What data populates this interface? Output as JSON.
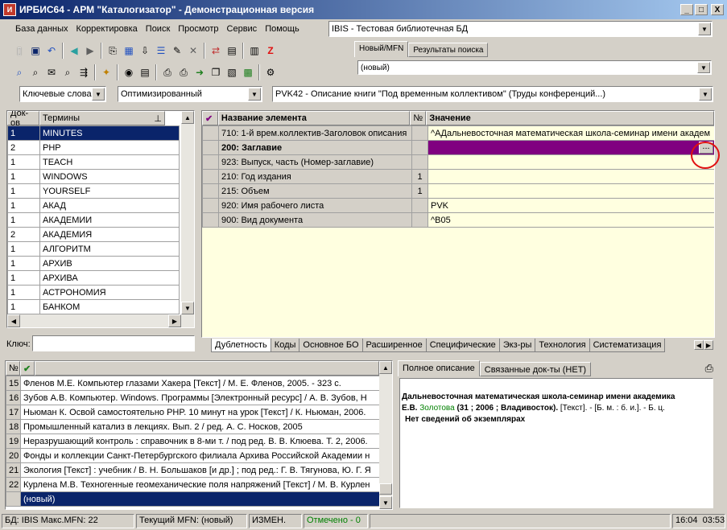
{
  "window": {
    "title": "ИРБИС64 - АРМ \"Каталогизатор\" - Демонстрационная версия",
    "min": "_",
    "max": "□",
    "close": "X"
  },
  "menu": [
    "База данных",
    "Корректировка",
    "Поиск",
    "Просмотр",
    "Сервис",
    "Помощь"
  ],
  "db_select": "IBIS - Тестовая библиотечная БД",
  "top_tabs": [
    "Новый/MFN",
    "Результаты поиска"
  ],
  "mfn_select": "(новый)",
  "search_mode": "Ключевые слова",
  "search_type": "Оптимизированный",
  "worksheet": "PVK42 - Описание книги \"Под временным коллективом\" (Труды конференций...)",
  "dict": {
    "col_docs": "Док-ов",
    "col_terms": "Термины",
    "key_label": "Ключ:",
    "rows": [
      [
        "1",
        "MINUTES"
      ],
      [
        "2",
        "PHP"
      ],
      [
        "1",
        "TEACH"
      ],
      [
        "1",
        "WINDOWS"
      ],
      [
        "1",
        "YOURSELF"
      ],
      [
        "1",
        "АКАД"
      ],
      [
        "1",
        "АКАДЕМИИ"
      ],
      [
        "2",
        "АКАДЕМИЯ"
      ],
      [
        "1",
        "АЛГОРИТМ"
      ],
      [
        "1",
        "АРХИВ"
      ],
      [
        "1",
        "АРХИВА"
      ],
      [
        "1",
        "АСТРОНОМИЯ"
      ],
      [
        "1",
        "БАНКОМ"
      ]
    ]
  },
  "editor": {
    "col_name": "Название элемента",
    "col_num": "№",
    "col_value": "Значение",
    "rows": [
      {
        "name": "710: 1-й врем.коллектив-Заголовок описания",
        "num": "",
        "value": "^AДальневосточная математическая школа-семинар имени академ"
      },
      {
        "name": "200: Заглавие",
        "num": "",
        "value": ""
      },
      {
        "name": "923: Выпуск, часть (Номер-заглавие)",
        "num": "",
        "value": ""
      },
      {
        "name": "210: Год издания",
        "num": "1",
        "value": ""
      },
      {
        "name": "215: Объем",
        "num": "1",
        "value": ""
      },
      {
        "name": "920: Имя рабочего листа",
        "num": "",
        "value": "PVK"
      },
      {
        "name": "900: Вид документа",
        "num": "",
        "value": "^B05"
      }
    ],
    "ellipsis": "..."
  },
  "bottom_tabs": [
    "Дублетность",
    "Коды",
    "Основное БО",
    "Расширенное",
    "Специфические",
    "Экз-ры",
    "Технология",
    "Систематизация"
  ],
  "doclist": {
    "col_no": "№",
    "rows": [
      [
        "15",
        "Фленов М.Е. Компьютер глазами Хакера [Текст] / М. Е. Фленов, 2005. - 323 с."
      ],
      [
        "16",
        "Зубов А.В. Компьютер. Windows. Программы [Электронный ресурс] / А. В. Зубов, Н"
      ],
      [
        "17",
        "Ньюман К. Освой самостоятельно PHP. 10 минут на урок [Текст] / К. Ньюман, 2006."
      ],
      [
        "18",
        "Промышленный катализ в лекциях. Вып. 2 / ред. А. С. Носков, 2005"
      ],
      [
        "19",
        "Неразрушающий контроль : справочник в 8-ми т. / под ред. В. В. Клюева. Т. 2, 2006."
      ],
      [
        "20",
        "Фонды и коллекции Санкт-Петербургского филиала Архива Российской Академии н"
      ],
      [
        "21",
        "Экология [Текст] : учебник / В. Н. Большаков [и др.] ; под ред.: Г. В. Тягунова, Ю. Г. Я"
      ],
      [
        "22",
        "Курлена М.В. Техногенные геомеханические поля напряжений [Текст] / М. В. Курлен"
      ]
    ],
    "new_row": "(новый)"
  },
  "preview_tabs": [
    "Полное описание",
    "Связанные док-ты (НЕТ)"
  ],
  "preview": {
    "line1": "Дальневосточная математическая школа-семинар имени академика",
    "line2a": "Е.В. ",
    "line2b": "Золотова",
    "line2c": " (31 ; 2006 ; Владивосток).",
    "line2d": "  [Текст]. - [Б. м. : б. и.]. - Б. ц.",
    "line3": "Нет сведений об экземплярах"
  },
  "status": {
    "db": "БД: IBIS Макс.MFN: 22",
    "mfn": "Текущий MFN: (новый)",
    "mod": "ИЗМЕН.",
    "marked": "Отмечено - 0",
    "time": "16:04  03:53"
  },
  "colors": {
    "title": "#0a246a",
    "selection": "#0a246a",
    "edit_row": "#800080",
    "editor_bg": "#ffffe0",
    "annotation": "#e01010",
    "marked": "#008000"
  }
}
